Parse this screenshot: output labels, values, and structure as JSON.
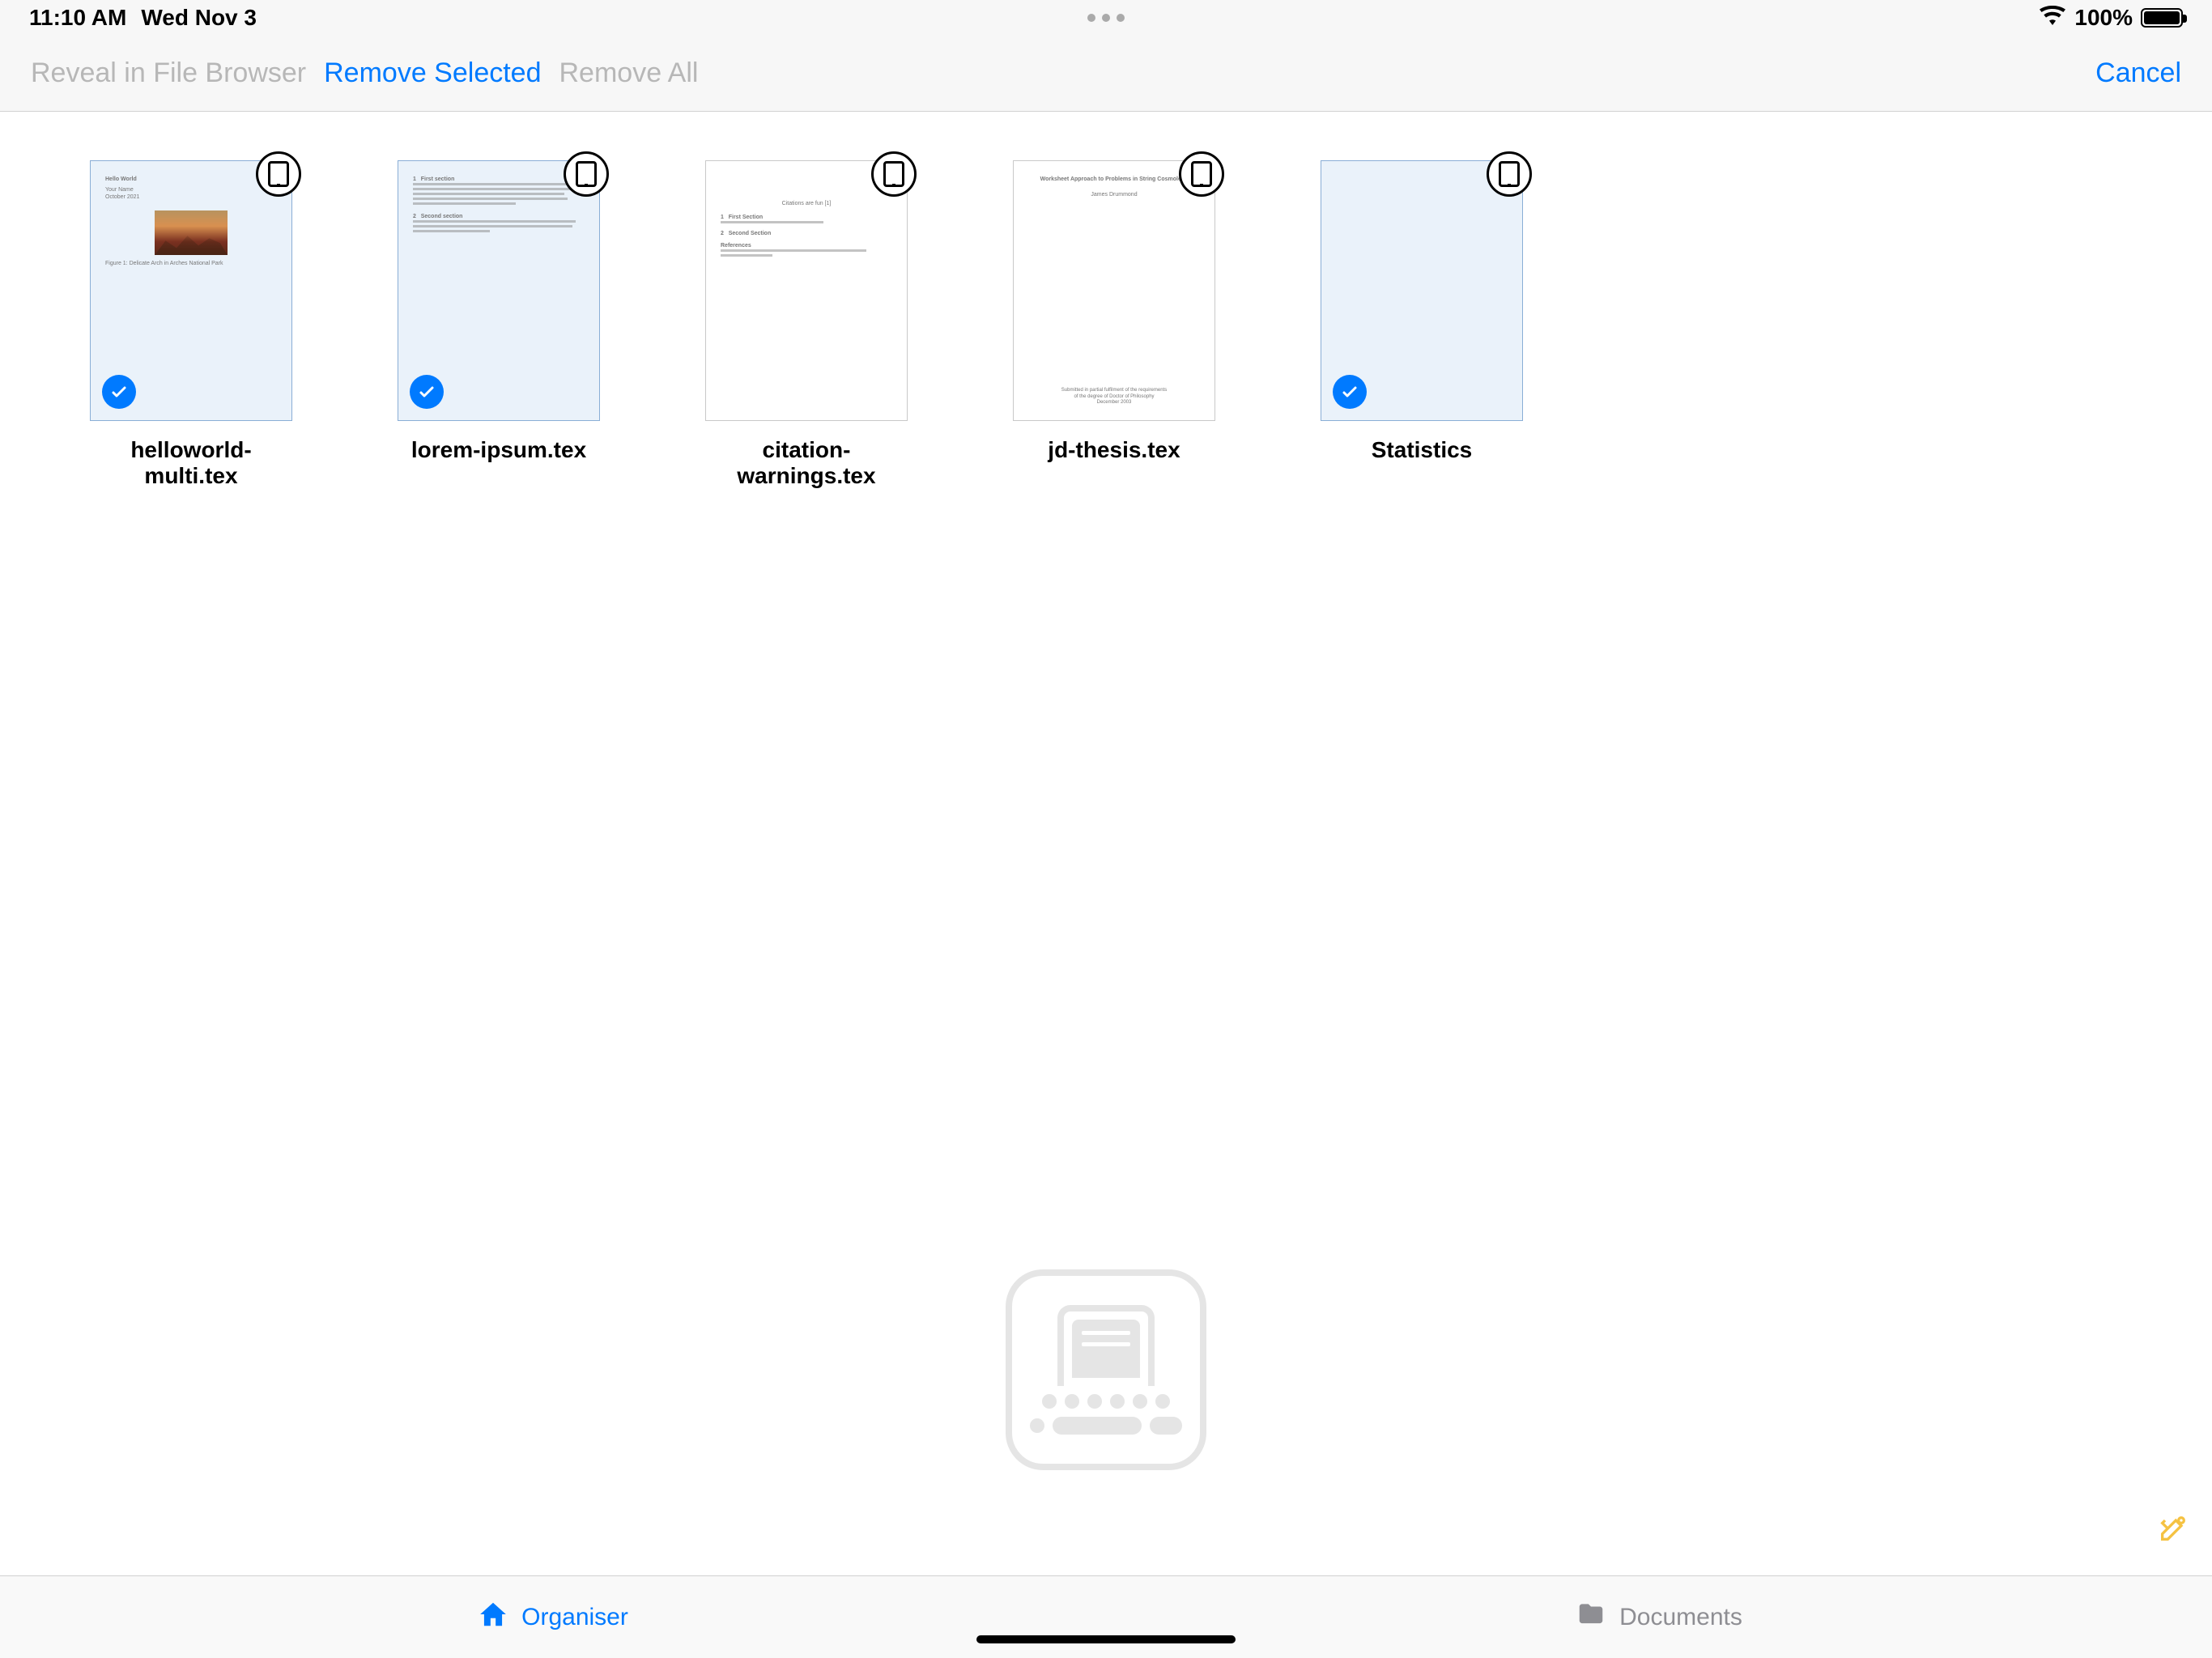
{
  "statusbar": {
    "time": "11:10 AM",
    "date": "Wed Nov 3",
    "battery": "100%"
  },
  "toolbar": {
    "reveal": "Reveal in File Browser",
    "removeSelected": "Remove Selected",
    "removeAll": "Remove All",
    "cancel": "Cancel"
  },
  "files": [
    {
      "label": "helloworld-multi.tex",
      "selected": true,
      "preview": "img"
    },
    {
      "label": "lorem-ipsum.tex",
      "selected": true,
      "preview": "lorem"
    },
    {
      "label": "citation-warnings.tex",
      "selected": false,
      "preview": "citations"
    },
    {
      "label": "jd-thesis.tex",
      "selected": false,
      "preview": "thesis"
    },
    {
      "label": "Statistics",
      "selected": true,
      "preview": "blank"
    }
  ],
  "tabs": {
    "organiser": "Organiser",
    "documents": "Documents"
  }
}
